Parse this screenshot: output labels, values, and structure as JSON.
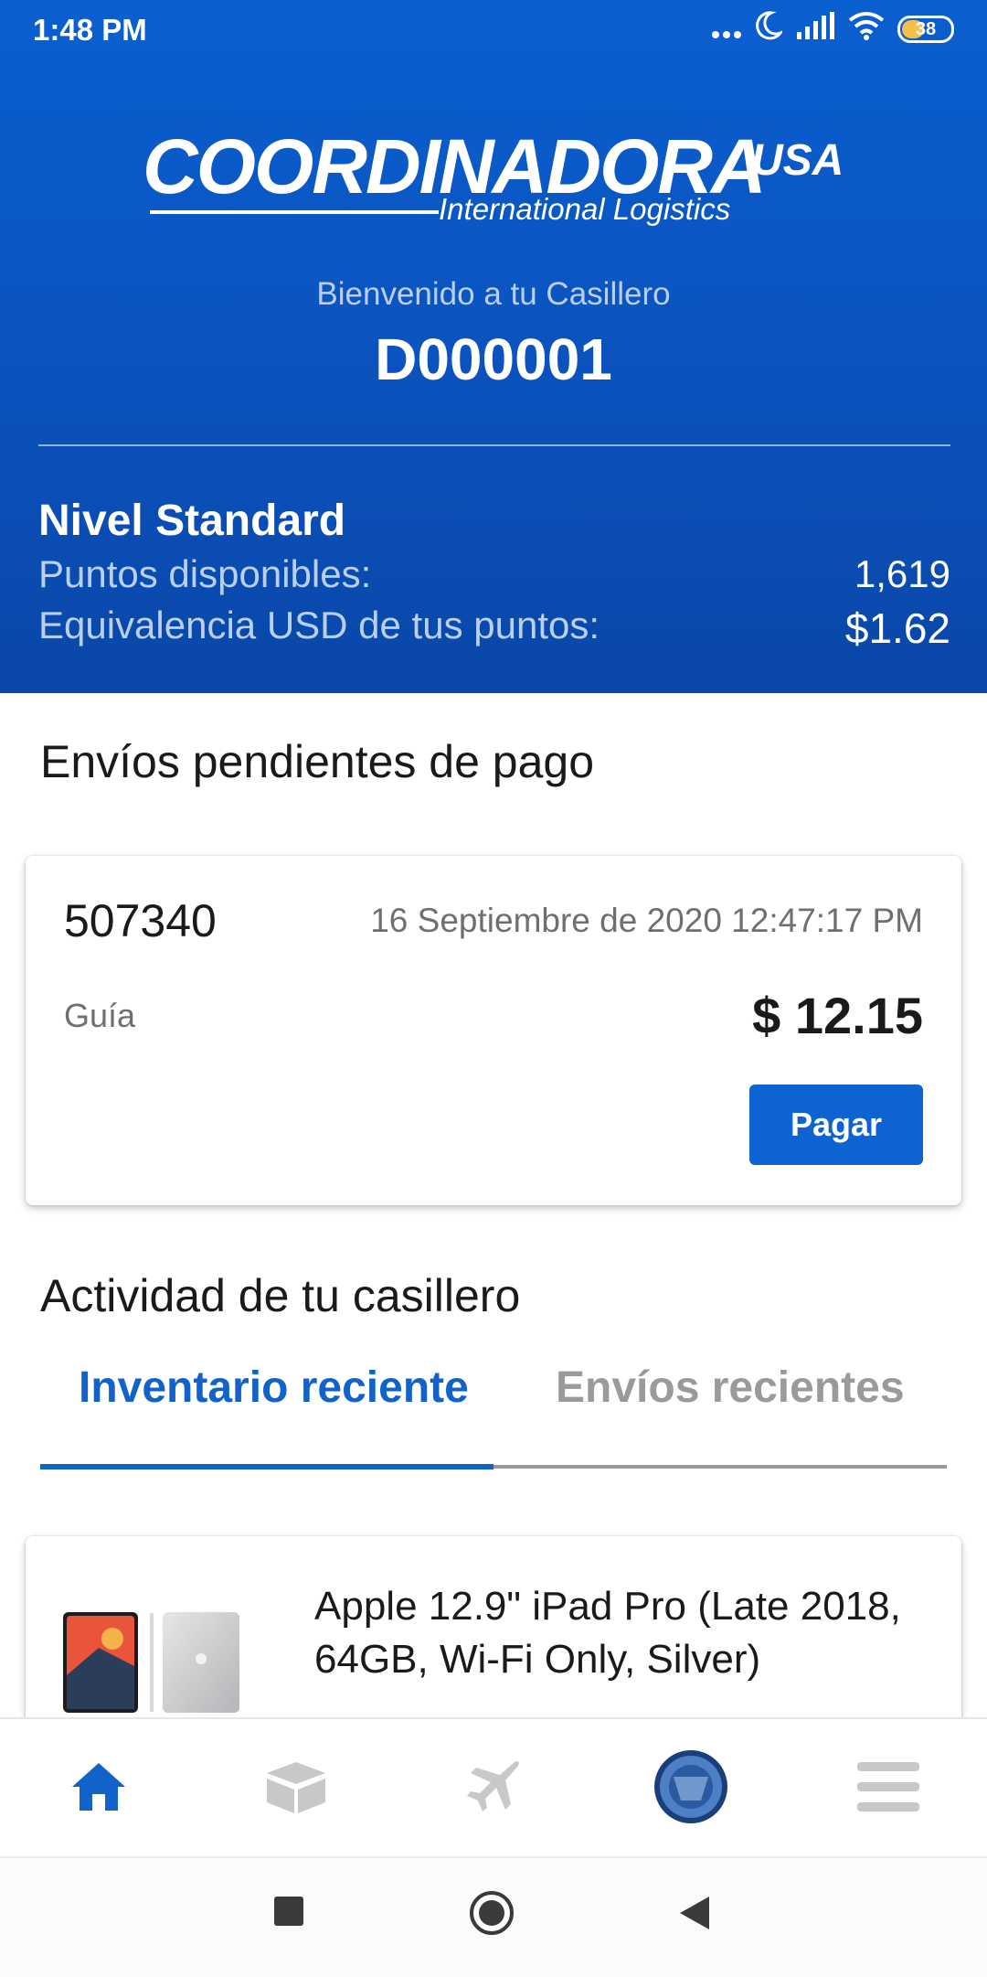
{
  "status_bar": {
    "time": "1:48 PM",
    "battery": "38"
  },
  "header": {
    "logo_brand": "COORDINADORA",
    "logo_usa": "USA",
    "logo_subtitle": "International Logistics",
    "welcome": "Bienvenido a tu Casillero",
    "locker_id": "D000001",
    "level": "Nivel Standard",
    "points_label": "Puntos disponibles:",
    "points_value": "1,619",
    "usd_label": "Equivalencia USD de tus puntos:",
    "usd_value": "$1.62"
  },
  "pending": {
    "title": "Envíos pendientes de pago",
    "shipment_number": "507340",
    "date": "16 Septiembre de 2020 12:47:17 PM",
    "guide_label": "Guía",
    "amount": "$ 12.15",
    "pay_button": "Pagar"
  },
  "activity": {
    "title": "Actividad de tu casillero",
    "tabs": [
      {
        "label": "Inventario reciente",
        "active": true
      },
      {
        "label": "Envíos recientes",
        "active": false
      }
    ],
    "inventory": [
      {
        "name": "Apple 12.9\" iPad Pro (Late 2018, 64GB, Wi-Fi Only, Silver)"
      }
    ]
  },
  "bottom_nav": {
    "items": [
      "home-icon",
      "package-icon",
      "airplane-icon",
      "profile-avatar",
      "menu-icon"
    ],
    "active": "home-icon"
  },
  "colors": {
    "primary": "#0d63d1",
    "header_top": "#0a5fd0",
    "header_bottom": "#0a47a8",
    "inactive": "#9a9a9a"
  }
}
